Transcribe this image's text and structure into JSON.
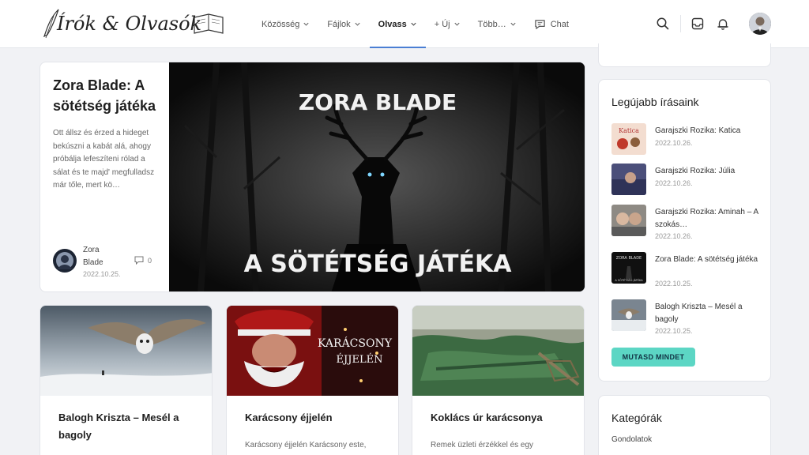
{
  "header": {
    "logo_text": "Írók & Olvasók",
    "nav": [
      {
        "label": "Közösség",
        "dropdown": true
      },
      {
        "label": "Fájlok",
        "dropdown": true
      },
      {
        "label": "Olvass",
        "dropdown": true,
        "active": true
      },
      {
        "label": "+ Új",
        "dropdown": true
      },
      {
        "label": "Több…",
        "dropdown": true
      },
      {
        "label": "Chat",
        "dropdown": false
      }
    ],
    "icons": [
      "search-icon",
      "inbox-icon",
      "bell-icon"
    ]
  },
  "featured": {
    "title": "Zora Blade: A sötétség játéka",
    "excerpt": "Ott állsz és érzed a hideget bekúszni a kabát alá, ahogy próbálja lefeszíteni rólad a sálat és te majd' megfulladsz már tőle, mert kö…",
    "author": "Zora Blade",
    "date": "2022.10.25.",
    "comments": "0",
    "image_text_top": "ZORA BLADE",
    "image_text_bottom": "A SÖTÉTSÉG JÁTÉKA"
  },
  "posts": [
    {
      "title": "Balogh Kriszta – Mesél a bagoly",
      "excerpt": ""
    },
    {
      "title": "Karácsony éjjelén",
      "excerpt": "Karácsony éjjelén Karácsony este,",
      "image_text_1": "KARÁCSONY",
      "image_text_2": "ÉJJELÉN"
    },
    {
      "title": "Koklács úr karácsonya",
      "excerpt": "Remek üzleti érzékkel és egy"
    }
  ],
  "sidebar": {
    "latest_title": "Legújabb írásaink",
    "latest": [
      {
        "title": "Garajszki Rozika: Katica",
        "date": "2022.10.26.",
        "thumb_text": "Katica"
      },
      {
        "title": "Garajszki Rozika: Júlia",
        "date": "2022.10.26."
      },
      {
        "title": "Garajszki Rozika: Aminah – A szokás…",
        "date": "2022.10.26."
      },
      {
        "title": "Zora Blade: A sötétség játéka",
        "date": "2022.10.25.",
        "thumb_text_1": "ZORA BLADE",
        "thumb_text_2": "A SÖTÉTSÉG JÁTÉKA"
      },
      {
        "title": "Balogh Kriszta – Mesél a bagoly",
        "date": "2022.10.25."
      }
    ],
    "show_all": "MUTASD MINDET",
    "categories_title": "Kategórák",
    "categories": [
      "Gondolatok"
    ]
  },
  "colors": {
    "accent": "#4a7fd4",
    "button": "#5cd6c4"
  }
}
